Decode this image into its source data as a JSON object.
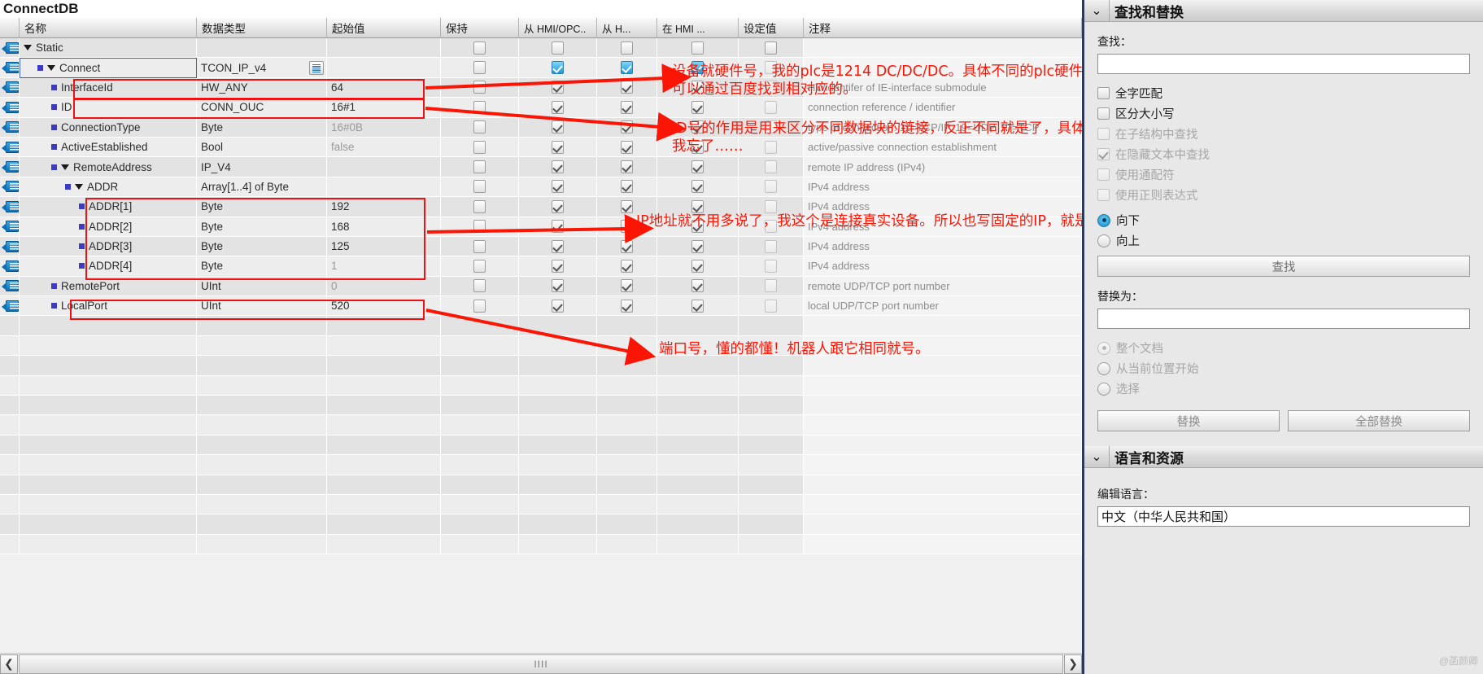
{
  "editor": {
    "db_title": "ConnectDB",
    "columns": [
      {
        "label": "",
        "key": "icon"
      },
      {
        "label": "名称",
        "key": "name"
      },
      {
        "label": "数据类型",
        "key": "datatype"
      },
      {
        "label": "起始值",
        "key": "initial"
      },
      {
        "label": "保持",
        "key": "retain"
      },
      {
        "label": "从 HMI/OPC..",
        "key": "hmi_acc"
      },
      {
        "label": "从 H...",
        "key": "hmi_w"
      },
      {
        "label": "在 HMI ...",
        "key": "hmi_vis"
      },
      {
        "label": "设定值",
        "key": "setpoint"
      },
      {
        "label": "注释",
        "key": "comment"
      }
    ],
    "rows": [
      {
        "indent": 0,
        "expander": "down",
        "bullet": false,
        "name": "Static",
        "datatype": "",
        "initial": "",
        "initial_grey": false,
        "retain": "off",
        "hmi_acc": "off",
        "hmi_w": "off",
        "hmi_vis": "off",
        "setpoint": "off",
        "comment": ""
      },
      {
        "indent": 1,
        "expander": "down",
        "bullet": true,
        "name": "Connect",
        "datatype": "TCON_IP_v4",
        "initial": "",
        "initial_grey": false,
        "retain": "off",
        "hmi_acc": "sel",
        "hmi_w": "sel",
        "hmi_vis": "sel",
        "setpoint": "dim",
        "comment": "",
        "selected": true,
        "typebutton": true
      },
      {
        "indent": 2,
        "expander": "none",
        "bullet": true,
        "name": "InterfaceId",
        "datatype": "HW_ANY",
        "initial": "64",
        "initial_grey": false,
        "retain": "off",
        "hmi_acc": "on",
        "hmi_w": "on",
        "hmi_vis": "on",
        "setpoint": "dim",
        "comment": "HWidentifer of IE-interface submodule"
      },
      {
        "indent": 2,
        "expander": "none",
        "bullet": true,
        "name": "ID",
        "datatype": "CONN_OUC",
        "initial": "16#1",
        "initial_grey": false,
        "retain": "off",
        "hmi_acc": "on",
        "hmi_w": "on",
        "hmi_vis": "on",
        "setpoint": "dim",
        "comment": "connection reference / identifier"
      },
      {
        "indent": 2,
        "expander": "none",
        "bullet": true,
        "name": "ConnectionType",
        "datatype": "Byte",
        "initial": "16#0B",
        "initial_grey": true,
        "retain": "off",
        "hmi_acc": "on",
        "hmi_w": "on",
        "hmi_vis": "on",
        "setpoint": "dim",
        "comment": "type of connection: 11=TCP/IP, 19=UDP, 17=TCP"
      },
      {
        "indent": 2,
        "expander": "none",
        "bullet": true,
        "name": "ActiveEstablished",
        "datatype": "Bool",
        "initial": "false",
        "initial_grey": true,
        "retain": "off",
        "hmi_acc": "on",
        "hmi_w": "on",
        "hmi_vis": "on",
        "setpoint": "dim",
        "comment": "active/passive connection establishment"
      },
      {
        "indent": 2,
        "expander": "down",
        "bullet": true,
        "name": "RemoteAddress",
        "datatype": "IP_V4",
        "initial": "",
        "initial_grey": false,
        "retain": "off",
        "hmi_acc": "on",
        "hmi_w": "on",
        "hmi_vis": "on",
        "setpoint": "dim",
        "comment": "remote IP address (IPv4)"
      },
      {
        "indent": 3,
        "expander": "down",
        "bullet": true,
        "name": "ADDR",
        "datatype": "Array[1..4] of Byte",
        "initial": "",
        "initial_grey": false,
        "retain": "off",
        "hmi_acc": "on",
        "hmi_w": "on",
        "hmi_vis": "on",
        "setpoint": "dim",
        "comment": "IPv4 address"
      },
      {
        "indent": 4,
        "expander": "none",
        "bullet": true,
        "name": "ADDR[1]",
        "datatype": "Byte",
        "initial": "192",
        "initial_grey": false,
        "retain": "off",
        "hmi_acc": "on",
        "hmi_w": "on",
        "hmi_vis": "on",
        "setpoint": "dim",
        "comment": "IPv4 address"
      },
      {
        "indent": 4,
        "expander": "none",
        "bullet": true,
        "name": "ADDR[2]",
        "datatype": "Byte",
        "initial": "168",
        "initial_grey": false,
        "retain": "off",
        "hmi_acc": "on",
        "hmi_w": "on",
        "hmi_vis": "on",
        "setpoint": "dim",
        "comment": "IPv4 address"
      },
      {
        "indent": 4,
        "expander": "none",
        "bullet": true,
        "name": "ADDR[3]",
        "datatype": "Byte",
        "initial": "125",
        "initial_grey": false,
        "retain": "off",
        "hmi_acc": "on",
        "hmi_w": "on",
        "hmi_vis": "on",
        "setpoint": "dim",
        "comment": "IPv4 address"
      },
      {
        "indent": 4,
        "expander": "none",
        "bullet": true,
        "name": "ADDR[4]",
        "datatype": "Byte",
        "initial": "1",
        "initial_grey": true,
        "retain": "off",
        "hmi_acc": "on",
        "hmi_w": "on",
        "hmi_vis": "on",
        "setpoint": "dim",
        "comment": "IPv4 address"
      },
      {
        "indent": 2,
        "expander": "none",
        "bullet": true,
        "name": "RemotePort",
        "datatype": "UInt",
        "initial": "0",
        "initial_grey": true,
        "retain": "off",
        "hmi_acc": "on",
        "hmi_w": "on",
        "hmi_vis": "on",
        "setpoint": "dim",
        "comment": "remote UDP/TCP port number"
      },
      {
        "indent": 2,
        "expander": "none",
        "bullet": true,
        "name": "LocalPort",
        "datatype": "UInt",
        "initial": "520",
        "initial_grey": false,
        "retain": "off",
        "hmi_acc": "on",
        "hmi_w": "on",
        "hmi_vis": "on",
        "setpoint": "dim",
        "comment": "local UDP/TCP port number"
      }
    ],
    "annotations": [
      {
        "id": "ann-interfaceid",
        "text_line1": "设备就硬件号，我的plc是1214 DC/DC/DC。具体不同的plc硬件号可能不同，",
        "text_line2": "可以通过百度找到相对应的。"
      },
      {
        "id": "ann-id",
        "text_line1": "ID号的作用是用来区分不同数据块的链接，反正不同就是了，具体的看手册。",
        "text_line2": "我忘了……"
      },
      {
        "id": "ann-addr",
        "text_line1": "IP地址就不用多说了，我这个是连接真实设备。所以也写固定的IP，就是机器人的IP",
        "text_line2": ""
      },
      {
        "id": "ann-localport",
        "text_line1": "端口号，懂的都懂！机器人跟它相同就号。",
        "text_line2": ""
      }
    ],
    "scrollbar": {
      "left_arrow": "❮",
      "right_arrow": "❯",
      "grip": "IIII"
    }
  },
  "taskcard": {
    "find_replace": {
      "chevron": "⌄",
      "title": "查找和替换",
      "find_label": "查找：",
      "find_value": "",
      "find_placeholder": "",
      "options": [
        {
          "label": "全字匹配",
          "checked": false,
          "disabled": false
        },
        {
          "label": "区分大小写",
          "checked": false,
          "disabled": false
        },
        {
          "label": "在子结构中查找",
          "checked": false,
          "disabled": true
        },
        {
          "label": "在隐藏文本中查找",
          "checked": true,
          "disabled": true
        },
        {
          "label": "使用通配符",
          "checked": false,
          "disabled": true
        },
        {
          "label": "使用正则表达式",
          "checked": false,
          "disabled": true
        }
      ],
      "direction": [
        {
          "label": "向下",
          "selected": true
        },
        {
          "label": "向上",
          "selected": false
        }
      ],
      "find_button": "查找",
      "replace_label": "替换为：",
      "replace_value": "",
      "scope": [
        {
          "label": "整个文档",
          "selected": true
        },
        {
          "label": "从当前位置开始",
          "selected": false
        },
        {
          "label": "选择",
          "selected": false
        }
      ],
      "replace_button": "替换",
      "replace_all_button": "全部替换"
    },
    "language_resources": {
      "chevron": "⌄",
      "title": "语言和资源",
      "edit_language_label": "编辑语言：",
      "edit_language_value": "中文（中华人民共和国）"
    },
    "watermark": "@菡颜卿"
  }
}
